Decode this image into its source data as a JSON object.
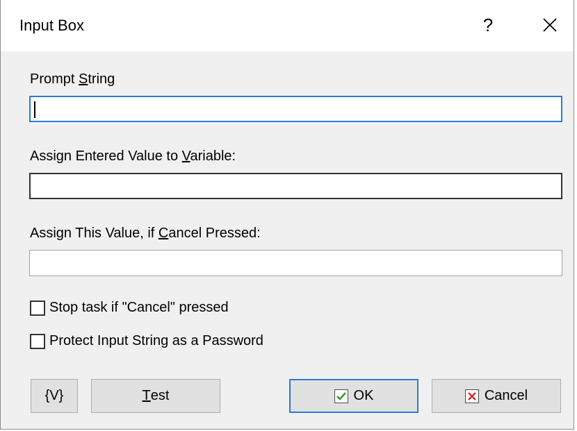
{
  "window": {
    "title": "Input Box",
    "help_label": "?"
  },
  "fields": {
    "prompt": {
      "label_pre": "Prompt ",
      "label_key": "S",
      "label_post": "tring",
      "value": ""
    },
    "variable": {
      "label_pre": "Assign Entered Value to ",
      "label_key": "V",
      "label_post": "ariable:",
      "value": ""
    },
    "cancel_value": {
      "label_pre": "Assign This Value, if ",
      "label_key": "C",
      "label_post": "ancel Pressed:",
      "value": ""
    }
  },
  "checkboxes": {
    "stop_task": {
      "label": "Stop task if \"Cancel\" pressed",
      "checked": false
    },
    "protect_password": {
      "label": "Protect Input String as a Password",
      "checked": false
    }
  },
  "buttons": {
    "variables": "{V}",
    "test_key": "T",
    "test_rest": "est",
    "ok": "OK",
    "cancel": "Cancel"
  },
  "colors": {
    "accent": "#2b7ad6",
    "ok_check": "#2e9e2e",
    "cancel_x": "#d42a2a"
  }
}
